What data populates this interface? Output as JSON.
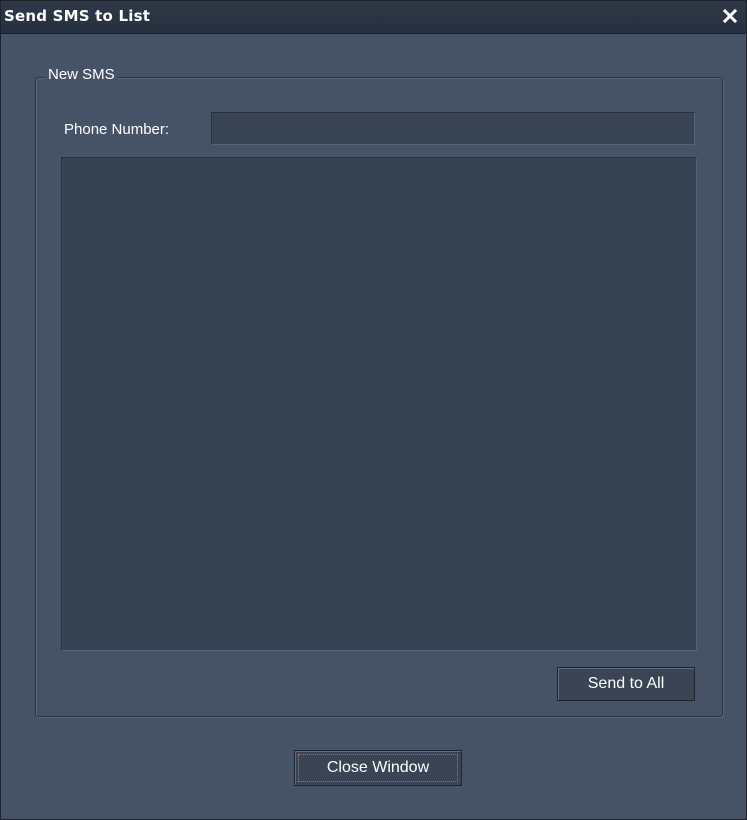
{
  "window": {
    "title": "Send SMS to List",
    "close_icon": "close-icon"
  },
  "group": {
    "legend": "New SMS"
  },
  "phone": {
    "label": "Phone Number:",
    "value": "",
    "placeholder": ""
  },
  "message": {
    "value": ""
  },
  "buttons": {
    "send_all": "Send to All",
    "close_window": "Close Window"
  },
  "colors": {
    "window_bg": "#465367",
    "titlebar_bg": "#263040",
    "input_bg": "#374252",
    "button_bg": "#3a4455",
    "focus_ring": "#d05a5a",
    "text": "#ffffff"
  }
}
